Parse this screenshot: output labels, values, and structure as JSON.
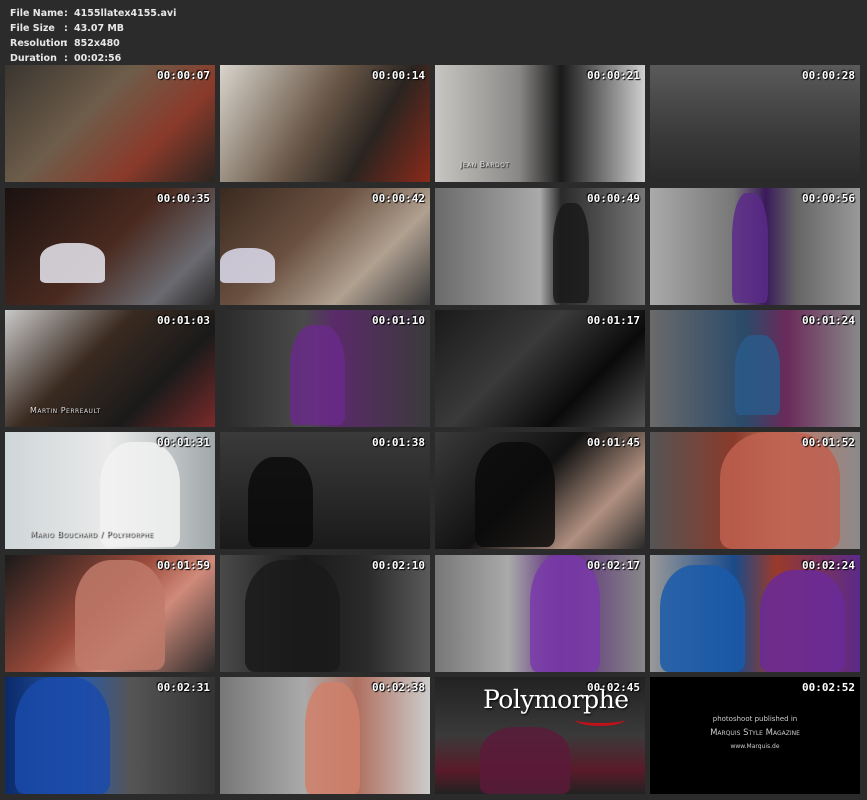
{
  "info": {
    "file_name_label": "File Name",
    "file_name": "4155llatex4155.avi",
    "file_size_label": "File Size",
    "file_size": "43.07 MB",
    "resolution_label": "Resolution",
    "resolution": "852x480",
    "duration_label": "Duration",
    "duration": "00:02:56",
    "separator": ":"
  },
  "thumbnails": [
    {
      "time": "00:00:07",
      "caption": ""
    },
    {
      "time": "00:00:14",
      "caption": ""
    },
    {
      "time": "00:00:21",
      "caption": "Jean Bardot"
    },
    {
      "time": "00:00:28",
      "caption": ""
    },
    {
      "time": "00:00:35",
      "caption": ""
    },
    {
      "time": "00:00:42",
      "caption": ""
    },
    {
      "time": "00:00:49",
      "caption": ""
    },
    {
      "time": "00:00:56",
      "caption": ""
    },
    {
      "time": "00:01:03",
      "caption": "Martin Perreault"
    },
    {
      "time": "00:01:10",
      "caption": ""
    },
    {
      "time": "00:01:17",
      "caption": ""
    },
    {
      "time": "00:01:24",
      "caption": ""
    },
    {
      "time": "00:01:31",
      "caption": "Mario Bouchard / Polymorphe"
    },
    {
      "time": "00:01:38",
      "caption": ""
    },
    {
      "time": "00:01:45",
      "caption": ""
    },
    {
      "time": "00:01:52",
      "caption": ""
    },
    {
      "time": "00:01:59",
      "caption": ""
    },
    {
      "time": "00:02:10",
      "caption": ""
    },
    {
      "time": "00:02:17",
      "caption": ""
    },
    {
      "time": "00:02:24",
      "caption": ""
    },
    {
      "time": "00:02:31",
      "caption": ""
    },
    {
      "time": "00:02:38",
      "caption": ""
    },
    {
      "time": "00:02:45",
      "caption": ""
    },
    {
      "time": "00:02:52",
      "caption": ""
    }
  ],
  "logo": "Polymorphe",
  "end_card": {
    "line1": "photoshoot published in",
    "line2": "Marquis Style Magazine",
    "line3": "www.Marquis.de"
  }
}
